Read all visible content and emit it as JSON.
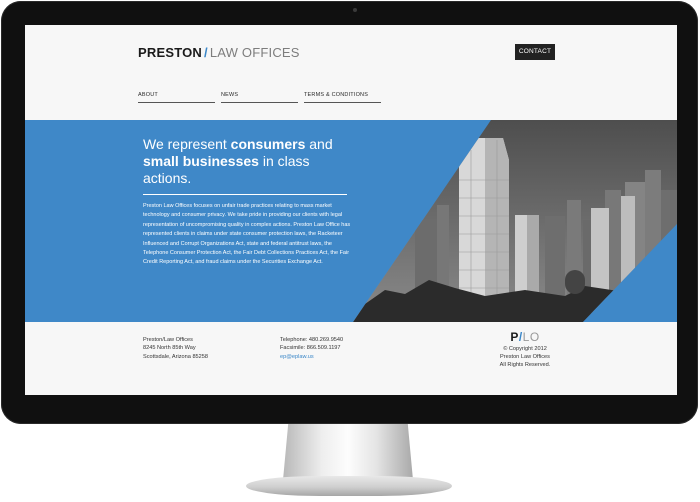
{
  "header": {
    "logo_main": "PRESTON",
    "logo_slash": "/",
    "logo_sub": "LAW OFFICES",
    "contact_label": "CONTACT"
  },
  "nav": {
    "items": [
      "ABOUT",
      "NEWS",
      "TERMS & CONDITIONS"
    ]
  },
  "hero": {
    "headline_1": "We represent ",
    "headline_2": "consumers",
    "headline_3": " and ",
    "headline_4": "small businesses",
    "headline_5": " in class actions.",
    "body": "Preston Law Offices focuses on unfair trade practices relating to mass market technology and consumer privacy. We take pride in providing our clients with legal representation of uncompromising quality in complex actions. Preston Law Office has represented clients in claims under state consumer protection laws, the Racketeer Influenced and Corrupt Organizations Act, state and federal antitrust laws, the Telephone Consumer Protection Act, the Fair Debt Collections Practices Act, the Fair Credit Reporting Act, and fraud claims under the Securities Exchange Act."
  },
  "footer": {
    "address": [
      "Preston/Law Offices",
      "8245 North 85th Way",
      "Scottsdale, Arizona 85258"
    ],
    "telephone": "Telephone: 480.269.9540",
    "facsimile": "Facsimile: 866.509.1197",
    "email": "ep@eplaw.us",
    "logo_p": "P",
    "logo_slash": "/",
    "logo_lo": "LO",
    "copyright": [
      "© Copyright 2012",
      "Preston Law Offices",
      "All Rights Reserved."
    ]
  },
  "colors": {
    "brand_blue": "#3f88c8",
    "dark": "#1b1b1b",
    "bezel": "#101010"
  }
}
